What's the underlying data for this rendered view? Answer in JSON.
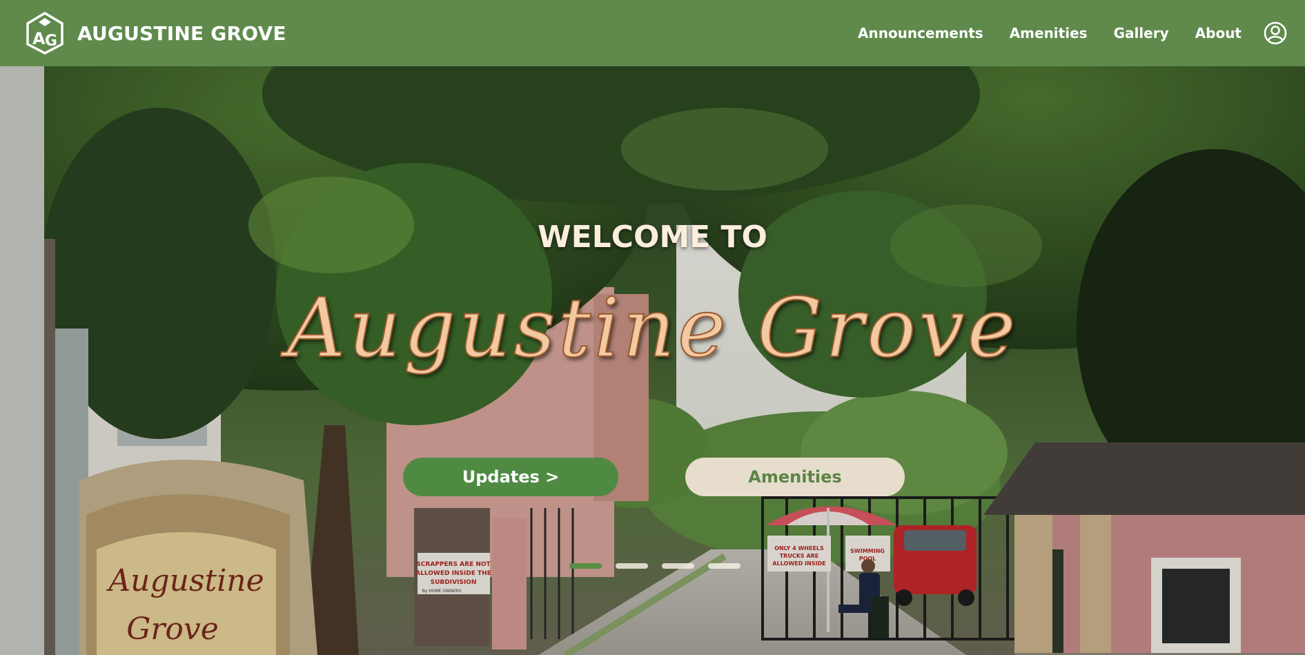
{
  "header": {
    "logo_icon": "augustine-grove-house-logo-icon",
    "brand_name": "AUGUSTINE GROVE",
    "nav": [
      {
        "label": "Announcements"
      },
      {
        "label": "Amenities"
      },
      {
        "label": "Gallery"
      },
      {
        "label": "About"
      }
    ],
    "account_icon": "user-circle-icon"
  },
  "hero": {
    "welcome": "WELCOME TO",
    "script_title": "Augustine Grove",
    "buttons": {
      "updates": "Updates >",
      "amenities": "Amenities"
    },
    "carousel": {
      "slides": 4,
      "active": 1
    },
    "photo_signs": {
      "entrance_sign": "Augustine Grove",
      "scrappers_sign": "SCRAPPERS ARE NOT ALLOWED INSIDE THE SUBDIVISION",
      "scrappers_sign_by": "By HOME OWNERS",
      "gate_sign": "ONLY 4 WHEELS TRUCKS ARE ALLOWED INSIDE",
      "pool_sign": "SWIMMING POOL"
    }
  },
  "colors": {
    "header_bg": "#5f8a4c",
    "updates_button_bg": "#4e8a42",
    "amenities_button_bg": "#e7ddcd",
    "amenities_button_text": "#5b8546",
    "title_fill": "#f2c9a0",
    "welcome_text": "#fbeedd"
  }
}
